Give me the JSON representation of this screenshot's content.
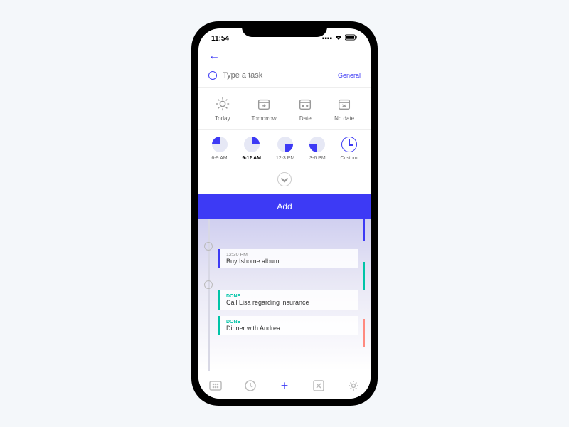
{
  "status": {
    "time": "11:54"
  },
  "input": {
    "placeholder": "Type a task",
    "category": "General"
  },
  "dates": {
    "today": "Today",
    "tomorrow": "Tomorrow",
    "date": "Date",
    "nodate": "No date"
  },
  "times": {
    "t1": "6-9 AM",
    "t2": "9-12 AM",
    "t3": "12-3 PM",
    "t4": "3-6 PM",
    "custom": "Custom"
  },
  "add_label": "Add",
  "tasks": {
    "a_time": "12:30 PM",
    "a_title": "Buy Ishome album",
    "b_status": "DONE",
    "b_title": "Call Lisa regarding insurance",
    "c_status": "DONE",
    "c_title": "Dinner with Andrea"
  }
}
